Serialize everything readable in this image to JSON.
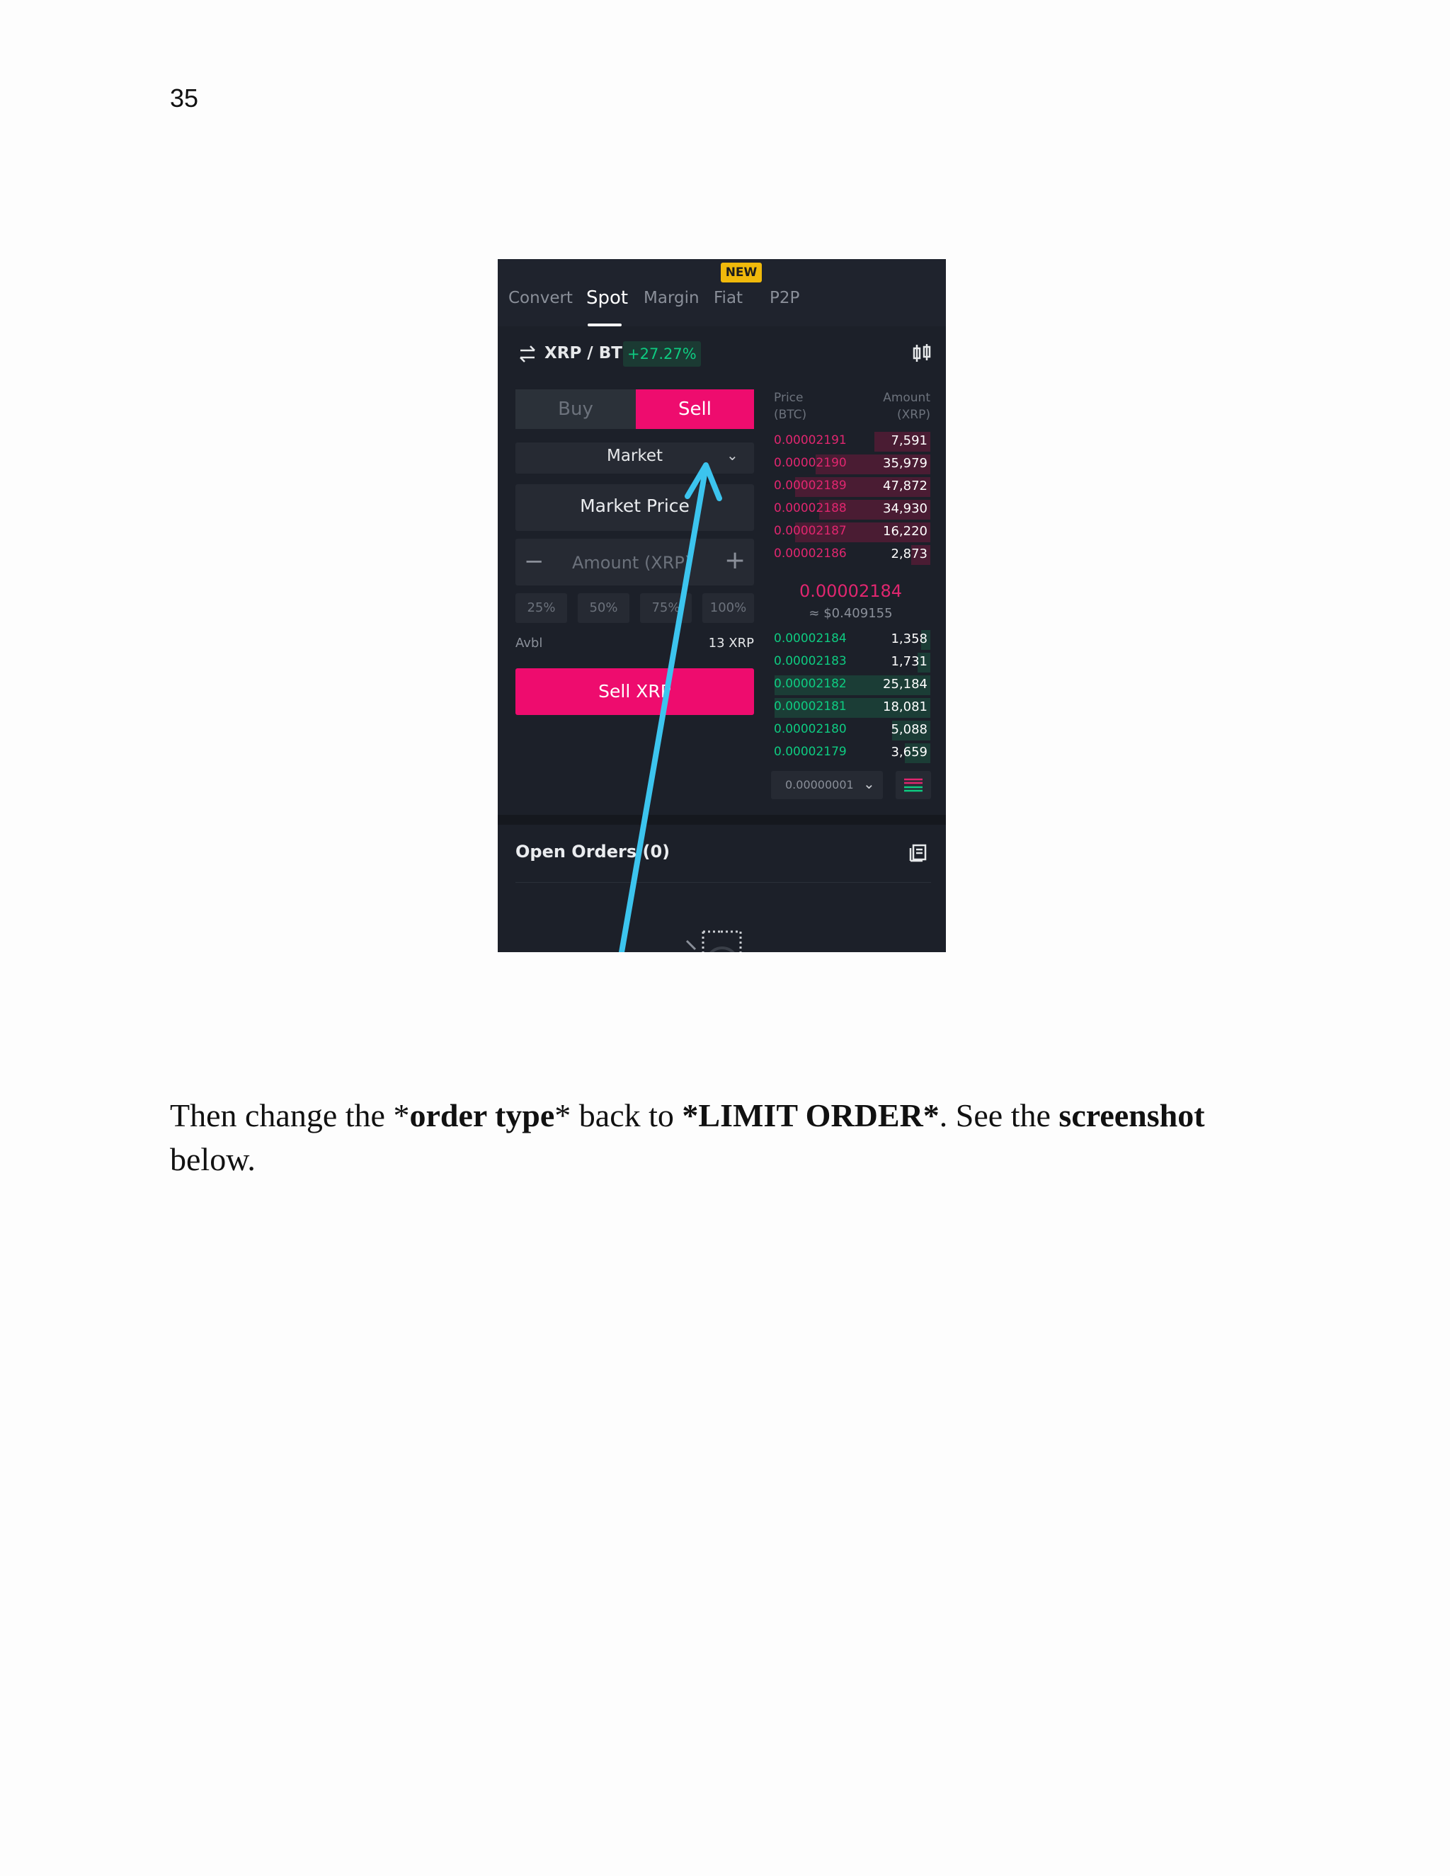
{
  "page_number": "35",
  "screenshot": {
    "tabs": [
      {
        "label": "Convert",
        "active": false
      },
      {
        "label": "Spot",
        "active": true
      },
      {
        "label": "Margin",
        "active": false
      },
      {
        "label": "Fiat",
        "active": false
      },
      {
        "label": "P2P",
        "active": false
      }
    ],
    "new_badge": "NEW",
    "pair": "XRP / BTC",
    "change": "+27.27%",
    "side_buttons": {
      "buy": "Buy",
      "sell": "Sell"
    },
    "order_type": "Market",
    "market_price": "Market Price",
    "amount_placeholder": "Amount (XRP)",
    "percent_buttons": [
      "25%",
      "50%",
      "75%",
      "100%"
    ],
    "avbl_label": "Avbl",
    "avbl_value": "13 XRP",
    "submit_label": "Sell XRP",
    "order_book": {
      "price_header_line1": "Price",
      "price_header_line2": "(BTC)",
      "amount_header_line1": "Amount",
      "amount_header_line2": "(XRP)",
      "asks": [
        {
          "price": "0.00002191",
          "amount": "7,591",
          "depth": 0.35
        },
        {
          "price": "0.00002190",
          "amount": "35,979",
          "depth": 0.72
        },
        {
          "price": "0.00002189",
          "amount": "47,872",
          "depth": 0.85
        },
        {
          "price": "0.00002188",
          "amount": "34,930",
          "depth": 0.7
        },
        {
          "price": "0.00002187",
          "amount": "16,220",
          "depth": 0.85
        },
        {
          "price": "0.00002186",
          "amount": "2,873",
          "depth": 0.12
        }
      ],
      "mid_price": "0.00002184",
      "mid_usd": "≈ $0.409155",
      "bids": [
        {
          "price": "0.00002184",
          "amount": "1,358",
          "depth": 0.06
        },
        {
          "price": "0.00002183",
          "amount": "1,731",
          "depth": 0.08
        },
        {
          "price": "0.00002182",
          "amount": "25,184",
          "depth": 0.98
        },
        {
          "price": "0.00002181",
          "amount": "18,081",
          "depth": 0.98
        },
        {
          "price": "0.00002180",
          "amount": "5,088",
          "depth": 0.24
        },
        {
          "price": "0.00002179",
          "amount": "3,659",
          "depth": 0.16
        }
      ],
      "precision": "0.00000001"
    },
    "open_orders": "Open Orders  (0)",
    "colors": {
      "sell": "#ee0c6e",
      "buy": "#0ecb81",
      "arrow": "#3cc4ee",
      "bg": "#1c2029"
    }
  },
  "caption": {
    "part1": "Then change the *",
    "bold1": "order type",
    "part2": "* back to ",
    "bold2": "*LIMIT ORDER*",
    "part3": ". See the ",
    "bold3": "screenshot",
    "part4": " below."
  }
}
